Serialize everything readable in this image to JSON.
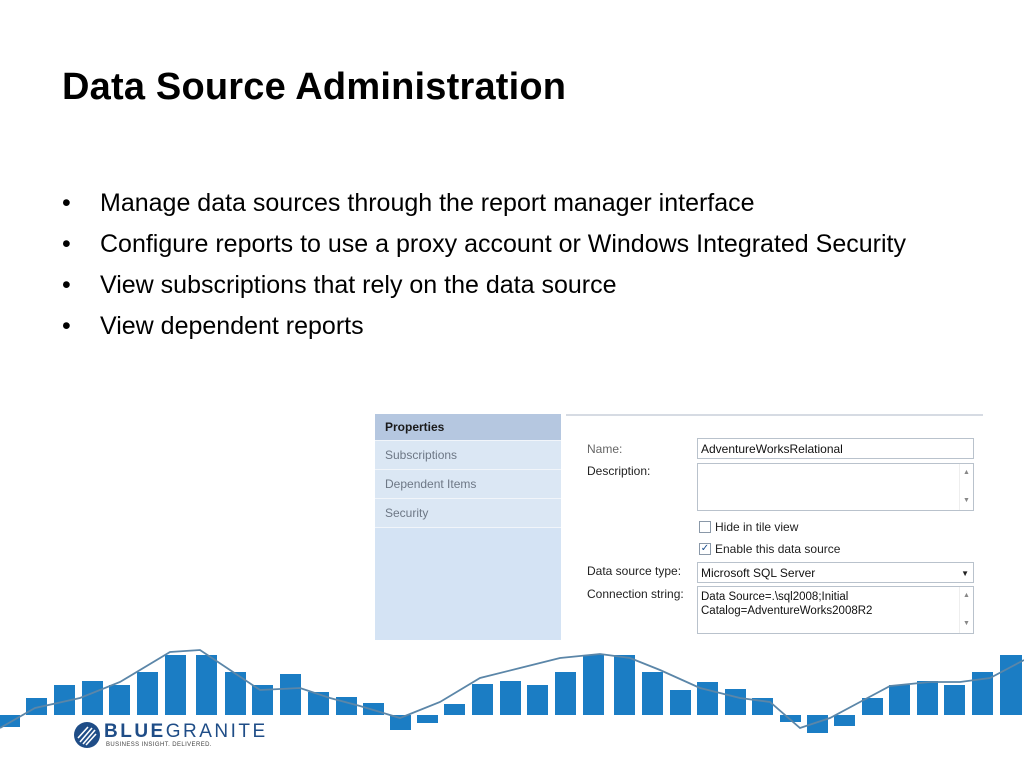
{
  "slide": {
    "title": "Data Source Administration",
    "bullet_char": "•",
    "bullets": [
      "Manage data sources through the report manager interface",
      "Configure reports to use a proxy account or Windows Integrated Security",
      "View subscriptions that rely on the data source",
      "View dependent reports"
    ]
  },
  "screenshot": {
    "nav": {
      "items": [
        {
          "label": "Properties",
          "active": true
        },
        {
          "label": "Subscriptions",
          "active": false
        },
        {
          "label": "Dependent Items",
          "active": false
        },
        {
          "label": "Security",
          "active": false
        }
      ]
    },
    "form": {
      "name_label": "Name:",
      "name_value": "AdventureWorksRelational",
      "description_label": "Description:",
      "description_value": "",
      "hide_tile_label": "Hide in tile view",
      "hide_tile_checked": false,
      "enable_label": "Enable this data source",
      "enable_checked": true,
      "type_label": "Data source type:",
      "type_value": "Microsoft SQL Server",
      "conn_label": "Connection string:",
      "conn_value": "Data Source=.\\sql2008;Initial Catalog=AdventureWorks2008R2"
    }
  },
  "footer": {
    "brand_bold": "BLUE",
    "brand_light": "GRANITE",
    "tagline": "BUSINESS INSIGHT. DELIVERED."
  },
  "colors": {
    "bar": "#1b7dc4",
    "line": "#5b86a8",
    "nav_bg": "#d4e3f4",
    "nav_active": "#b5c7e0",
    "brand": "#1f4d87"
  },
  "icons": {
    "checkbox": "check-icon",
    "dropdown": "chevron-down-icon",
    "scroll_up": "scroll-up-icon",
    "scroll_down": "scroll-down-icon",
    "logo": "bluegranite-logo-icon"
  }
}
